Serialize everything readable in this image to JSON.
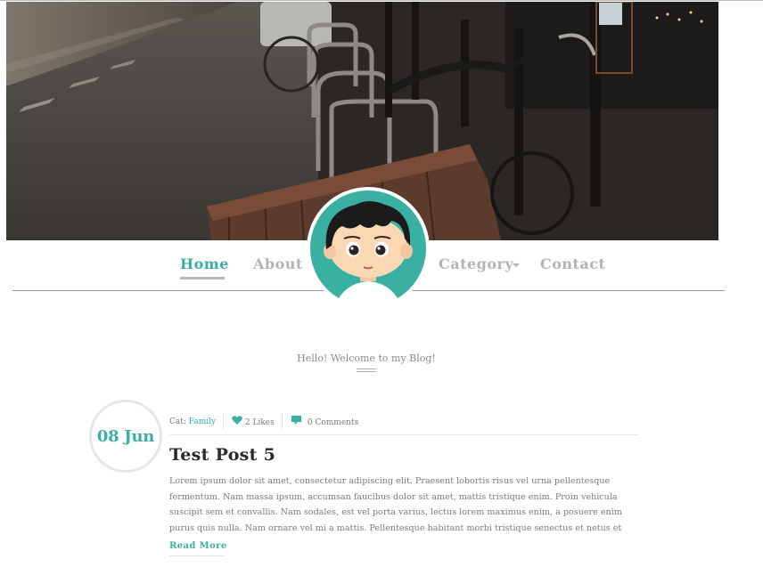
{
  "hero": {
    "image": "street-bicycle-photo"
  },
  "avatar": {
    "image": "cartoon-boy-avatar",
    "bg_color": "#3ab0a3"
  },
  "nav": {
    "items": [
      {
        "label": "Home",
        "active": true
      },
      {
        "label": "About",
        "active": false
      },
      {
        "label": "Category",
        "active": false,
        "has_dropdown": true
      },
      {
        "label": "Contact",
        "active": false
      }
    ],
    "accent": "#3ab0a3"
  },
  "welcome": {
    "text": "Hello! Welcome to my Blog!"
  },
  "post": {
    "date": "08 Jun",
    "category_prefix": "Cat: ",
    "category": "Family",
    "likes": "2 Likes",
    "comments": "0 Comments",
    "title": "Test Post 5",
    "excerpt": "Lorem ipsum dolor sit amet, consectetur adipiscing elit. Praesent lobortis risus vel urna pellentesque fermentum. Nam massa ipsum, accumsan faucibus dolor sit amet, mattis tristique enim. Proin vehicula suscipit sem et convallis. Nam sodales, est vel porta varius, lectus lorem maximus enim, a posuere enim purus quis nulla. Nam ornare vel mi a mattis. Pellentesque habitant morbi tristique senectus et netus et",
    "read_more": "Read More"
  }
}
